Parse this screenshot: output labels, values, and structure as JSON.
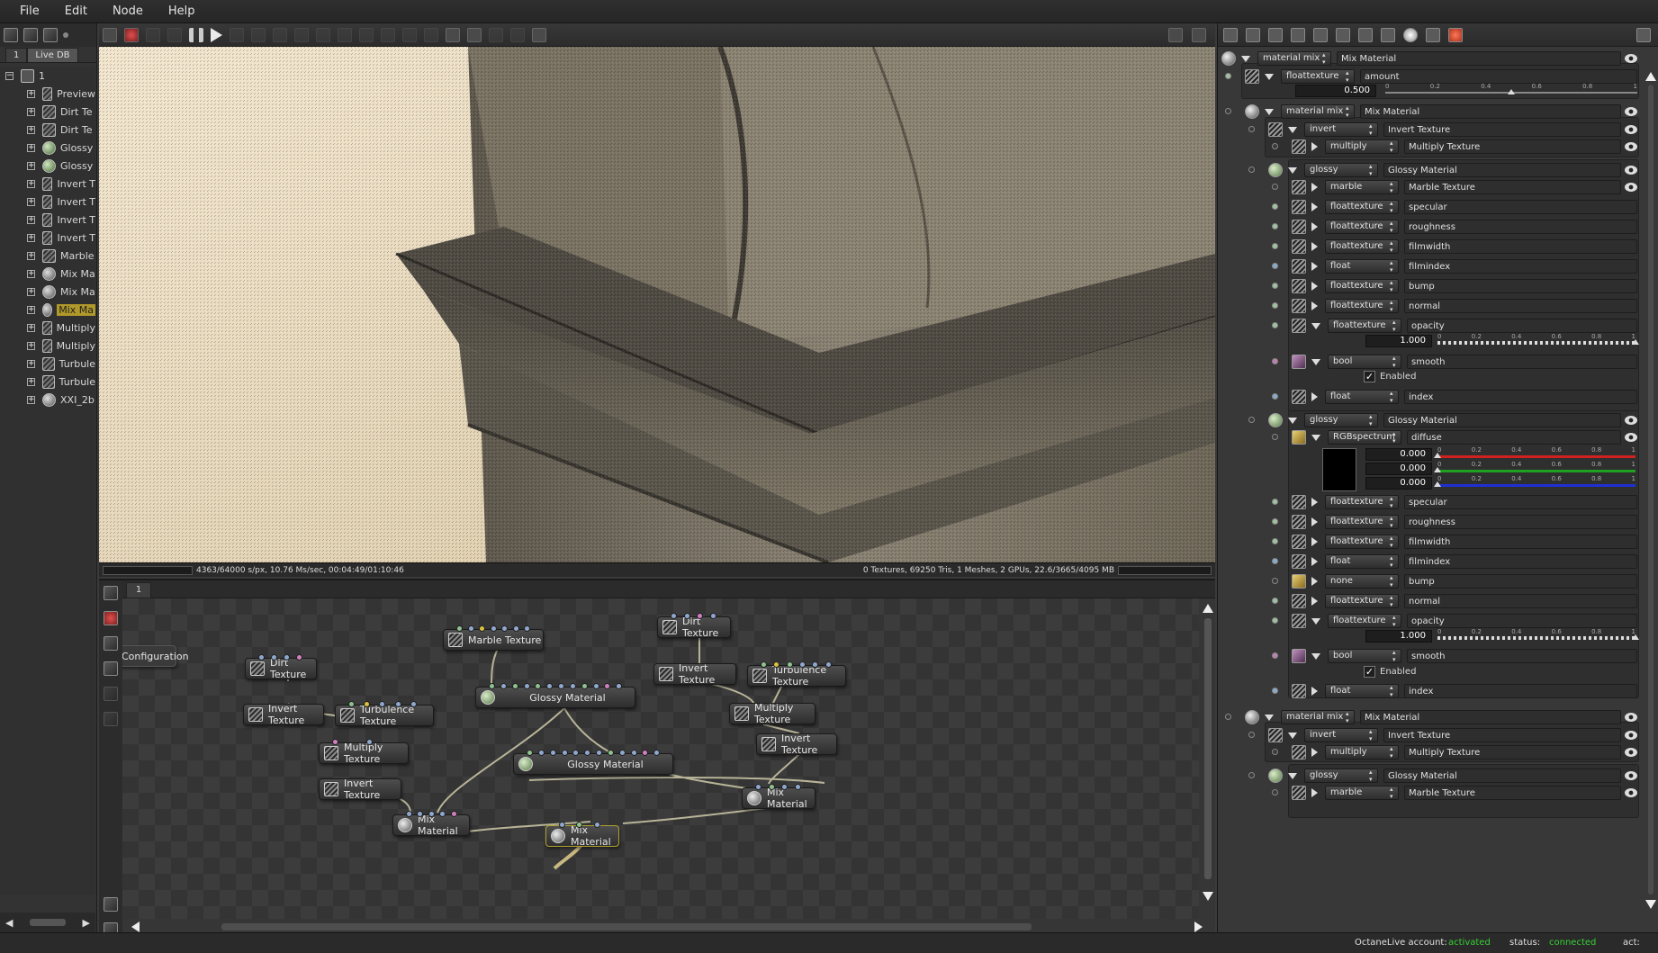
{
  "menu": [
    "File",
    "Edit",
    "Node",
    "Help"
  ],
  "outliner": {
    "tabs": [
      "1",
      "Live DB"
    ],
    "root": "1",
    "items": [
      {
        "label": "Preview",
        "type": "preview"
      },
      {
        "label": "Dirt Te",
        "type": "tex"
      },
      {
        "label": "Dirt Te",
        "type": "tex"
      },
      {
        "label": "Glossy",
        "type": "glossy"
      },
      {
        "label": "Glossy",
        "type": "glossy"
      },
      {
        "label": "Invert T",
        "type": "tex"
      },
      {
        "label": "Invert T",
        "type": "tex"
      },
      {
        "label": "Invert T",
        "type": "tex"
      },
      {
        "label": "Invert T",
        "type": "tex"
      },
      {
        "label": "Marble",
        "type": "tex"
      },
      {
        "label": "Mix Ma",
        "type": "mat"
      },
      {
        "label": "Mix Ma",
        "type": "mat"
      },
      {
        "label": "Mix Ma",
        "type": "mat",
        "selected": true
      },
      {
        "label": "Multiply",
        "type": "tex"
      },
      {
        "label": "Multiply",
        "type": "tex"
      },
      {
        "label": "Turbule",
        "type": "tex"
      },
      {
        "label": "Turbule",
        "type": "tex"
      },
      {
        "label": "XXI_2b",
        "type": "mat"
      }
    ]
  },
  "render_status": {
    "left": "4363/64000 s/px, 10.76 Ms/sec, 00:04:49/01:10:46",
    "right": "0 Textures, 69250 Tris, 1 Meshes, 2 GPUs, 22.6/3665/4095 MB"
  },
  "graph": {
    "tab": "1",
    "nodes": [
      {
        "label": "Configuration",
        "kind": "cfg"
      },
      {
        "label": "Dirt Texture",
        "kind": "tex"
      },
      {
        "label": "Invert Texture",
        "kind": "tex"
      },
      {
        "label": "Turbulence Texture",
        "kind": "tex"
      },
      {
        "label": "Multiply Texture",
        "kind": "tex"
      },
      {
        "label": "Invert Texture",
        "kind": "tex"
      },
      {
        "label": "Mix Material",
        "kind": "mat"
      },
      {
        "label": "Marble Texture",
        "kind": "tex"
      },
      {
        "label": "Glossy Material",
        "kind": "gl"
      },
      {
        "label": "Glossy Material",
        "kind": "gl"
      },
      {
        "label": "Mix Material",
        "kind": "mat",
        "selected": true
      },
      {
        "label": "Dirt Texture",
        "kind": "tex"
      },
      {
        "label": "Invert Texture",
        "kind": "tex"
      },
      {
        "label": "Turbulence Texture",
        "kind": "tex"
      },
      {
        "label": "Multiply Texture",
        "kind": "tex"
      },
      {
        "label": "Invert Texture",
        "kind": "tex"
      },
      {
        "label": "Mix Material",
        "kind": "mat"
      }
    ]
  },
  "inspector": {
    "rows": [
      {
        "type": "material mix",
        "name": "Mix Material"
      },
      {
        "type": "floattexture",
        "name": "amount"
      },
      {
        "type": "material mix",
        "name": "Mix Material"
      },
      {
        "type": "invert",
        "name": "Invert Texture"
      },
      {
        "type": "multiply",
        "name": "Multiply Texture"
      },
      {
        "type": "glossy",
        "name": "Glossy Material"
      },
      {
        "type": "marble",
        "name": "Marble Texture"
      },
      {
        "type": "floattexture",
        "name": "specular"
      },
      {
        "type": "floattexture",
        "name": "roughness"
      },
      {
        "type": "floattexture",
        "name": "filmwidth"
      },
      {
        "type": "float",
        "name": "filmindex"
      },
      {
        "type": "floattexture",
        "name": "bump"
      },
      {
        "type": "floattexture",
        "name": "normal"
      },
      {
        "type": "floattexture",
        "name": "opacity"
      },
      {
        "type": "bool",
        "name": "smooth"
      },
      {
        "type": "float",
        "name": "index"
      },
      {
        "type": "glossy",
        "name": "Glossy Material"
      },
      {
        "type": "RGBspectrum",
        "name": "diffuse"
      },
      {
        "type": "floattexture",
        "name": "specular"
      },
      {
        "type": "floattexture",
        "name": "roughness"
      },
      {
        "type": "floattexture",
        "name": "filmwidth"
      },
      {
        "type": "float",
        "name": "filmindex"
      },
      {
        "type": "none",
        "name": "bump"
      },
      {
        "type": "floattexture",
        "name": "normal"
      },
      {
        "type": "floattexture",
        "name": "opacity"
      },
      {
        "type": "bool",
        "name": "smooth"
      },
      {
        "type": "float",
        "name": "index"
      },
      {
        "type": "material mix",
        "name": "Mix Material"
      },
      {
        "type": "invert",
        "name": "Invert Texture"
      },
      {
        "type": "multiply",
        "name": "Multiply Texture"
      },
      {
        "type": "glossy",
        "name": "Glossy Material"
      },
      {
        "type": "marble",
        "name": "Marble Texture"
      }
    ],
    "amount": {
      "value": "0.500",
      "fraction": 0.5
    },
    "opacity1": {
      "value": "1.000",
      "fraction": 1.0
    },
    "opacity2": {
      "value": "1.000",
      "fraction": 1.0
    },
    "diffuse": {
      "r": "0.000",
      "g": "0.000",
      "b": "0.000"
    },
    "enabled_label": "Enabled",
    "ticks5": [
      "0",
      "0.2",
      "0.4",
      "0.6",
      "0.8",
      "1"
    ]
  },
  "status": {
    "account_label": "OctaneLive account:",
    "account_value": "activated",
    "status_label": "status:",
    "status_value": "connected",
    "act_label": "act:"
  },
  "colors": {
    "ok": "#36d136",
    "selection": "#b0982a"
  }
}
